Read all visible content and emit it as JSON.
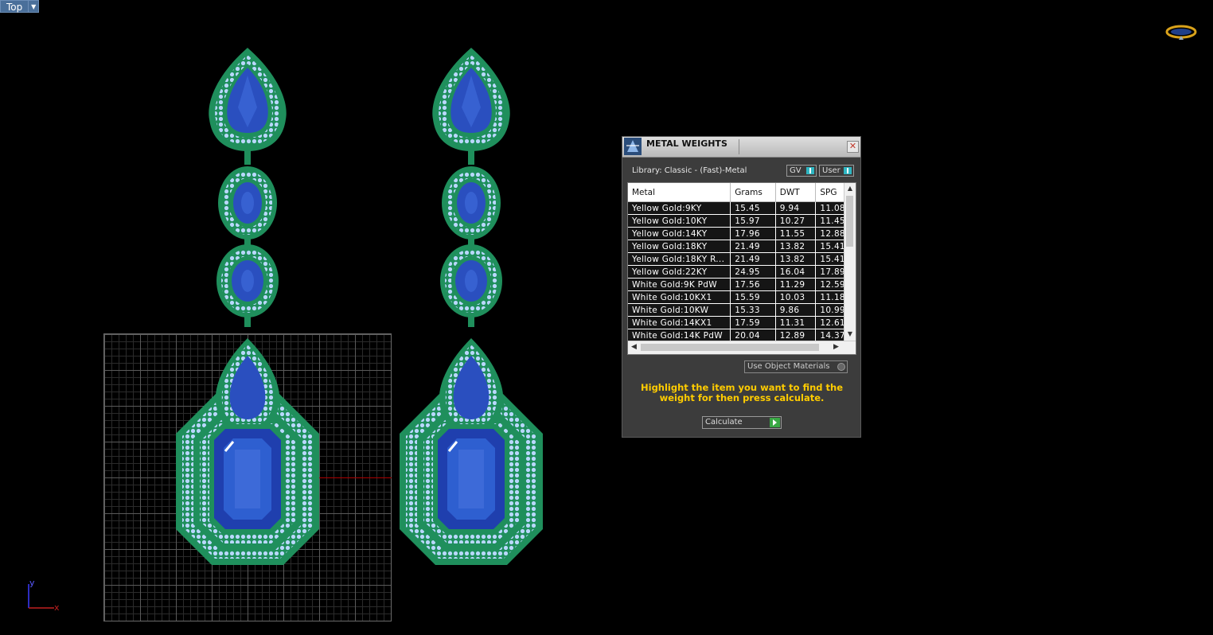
{
  "viewport": {
    "label": "Top"
  },
  "panel": {
    "title": "METAL WEIGHTS",
    "library": "Library: Classic - (Fast)-Metal",
    "toggle_gv": "GV",
    "toggle_user": "User",
    "columns": [
      "Metal",
      "Grams",
      "DWT",
      "SPG"
    ],
    "rows": [
      [
        "Yellow Gold:9KY",
        "15.45",
        "9.94",
        "11.08"
      ],
      [
        "Yellow Gold:10KY",
        "15.97",
        "10.27",
        "11.45"
      ],
      [
        "Yellow Gold:14KY",
        "17.96",
        "11.55",
        "12.88"
      ],
      [
        "Yellow Gold:18KY",
        "21.49",
        "13.82",
        "15.41"
      ],
      [
        "Yellow Gold:18KY R...",
        "21.49",
        "13.82",
        "15.41"
      ],
      [
        "Yellow Gold:22KY",
        "24.95",
        "16.04",
        "17.89"
      ],
      [
        "White Gold:9K PdW",
        "17.56",
        "11.29",
        "12.59"
      ],
      [
        "White Gold:10KX1",
        "15.59",
        "10.03",
        "11.18"
      ],
      [
        "White Gold:10KW",
        "15.33",
        "9.86",
        "10.99"
      ],
      [
        "White Gold:14KX1",
        "17.59",
        "11.31",
        "12.61"
      ],
      [
        "White Gold:14K PdW",
        "20.04",
        "12.89",
        "14.37"
      ]
    ],
    "use_object_materials": "Use Object Materials",
    "hint": "Highlight the item you want to find the weight for then press calculate.",
    "calculate_label": "Calculate"
  },
  "axis": {
    "y": "y",
    "x": "x"
  },
  "icons": {
    "app_icon": "scale-icon",
    "close": "close-icon",
    "logo": "ring-logo-icon"
  }
}
